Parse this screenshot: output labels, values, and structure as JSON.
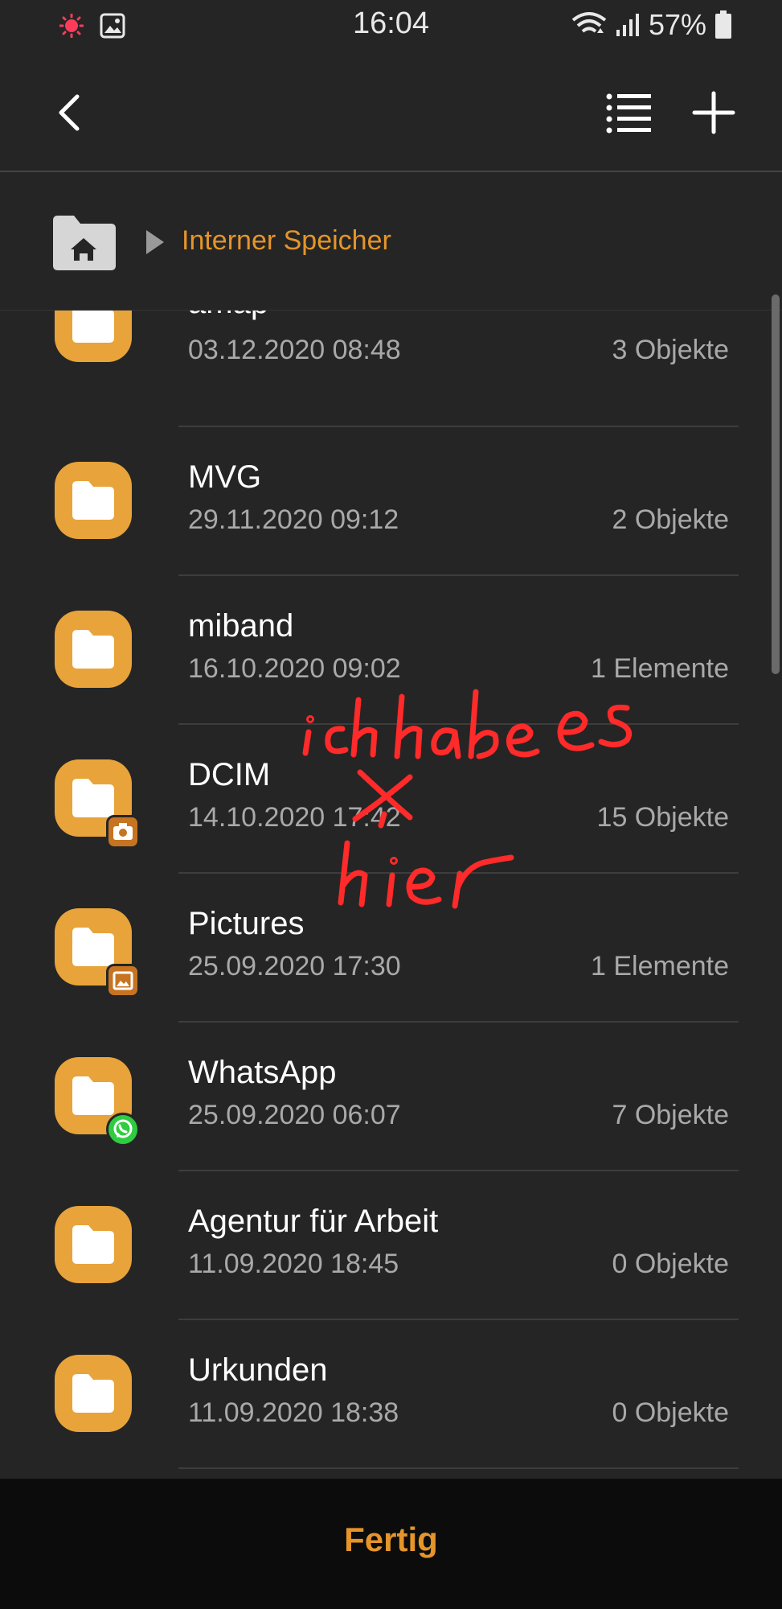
{
  "status_bar": {
    "time": "16:04",
    "battery_percent": "57%",
    "icons": [
      "recording-dot-icon",
      "gallery-notification-icon",
      "wifi-icon",
      "signal-icon",
      "battery-icon"
    ]
  },
  "app_bar": {
    "icons": [
      "back-arrow-icon",
      "list-view-icon",
      "add-icon"
    ]
  },
  "breadcrumb": {
    "home_icon": "home-folder-icon",
    "current": "Interner Speicher"
  },
  "folders": [
    {
      "name": "amap",
      "date": "03.12.2020 08:48",
      "count": "3 Objekte",
      "badge": null
    },
    {
      "name": "MVG",
      "date": "29.11.2020 09:12",
      "count": "2 Objekte",
      "badge": null
    },
    {
      "name": "miband",
      "date": "16.10.2020 09:02",
      "count": "1 Elemente",
      "badge": null
    },
    {
      "name": "DCIM",
      "date": "14.10.2020 17:42",
      "count": "15 Objekte",
      "badge": "camera-icon"
    },
    {
      "name": "Pictures",
      "date": "25.09.2020 17:30",
      "count": "1 Elemente",
      "badge": "image-icon"
    },
    {
      "name": "WhatsApp",
      "date": "25.09.2020 06:07",
      "count": "7 Objekte",
      "badge": "whatsapp-icon"
    },
    {
      "name": "Agentur für Arbeit",
      "date": "11.09.2020 18:45",
      "count": "0 Objekte",
      "badge": null
    },
    {
      "name": "Urkunden",
      "date": "11.09.2020 18:38",
      "count": "0 Objekte",
      "badge": null
    }
  ],
  "annotation": {
    "handwritten_text": "ich habe es x hier",
    "color": "#ff2a2a"
  },
  "bottom_bar": {
    "done_label": "Fertig"
  },
  "colors": {
    "background": "#252525",
    "accent": "#e5952a",
    "folder": "#e8a33a",
    "secondary_text": "#a9a9a9"
  }
}
